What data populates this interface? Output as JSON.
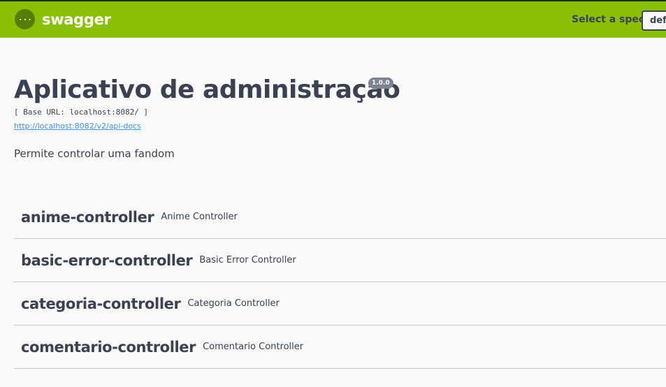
{
  "topbar": {
    "logo_text": "swagger",
    "spec_label": "Select a spec",
    "spec_selected": "defa"
  },
  "info": {
    "title": "Aplicativo de administração",
    "version": "1.0.0",
    "base_url": "[ Base URL: localhost:8082/ ]",
    "api_docs_link": "http://localhost:8082/v2/api-docs",
    "description": "Permite controlar uma fandom"
  },
  "tags": [
    {
      "name": "anime-controller",
      "description": "Anime Controller"
    },
    {
      "name": "basic-error-controller",
      "description": "Basic Error Controller"
    },
    {
      "name": "categoria-controller",
      "description": "Categoria Controller"
    },
    {
      "name": "comentario-controller",
      "description": "Comentario Controller"
    }
  ],
  "colors": {
    "topbar_bg": "#89bf04",
    "logo_circle": "#547f00",
    "text": "#3b4151",
    "link": "#4990e2",
    "badge_bg": "#7d8492"
  },
  "icons": {
    "logo": "swagger-logo-icon"
  }
}
